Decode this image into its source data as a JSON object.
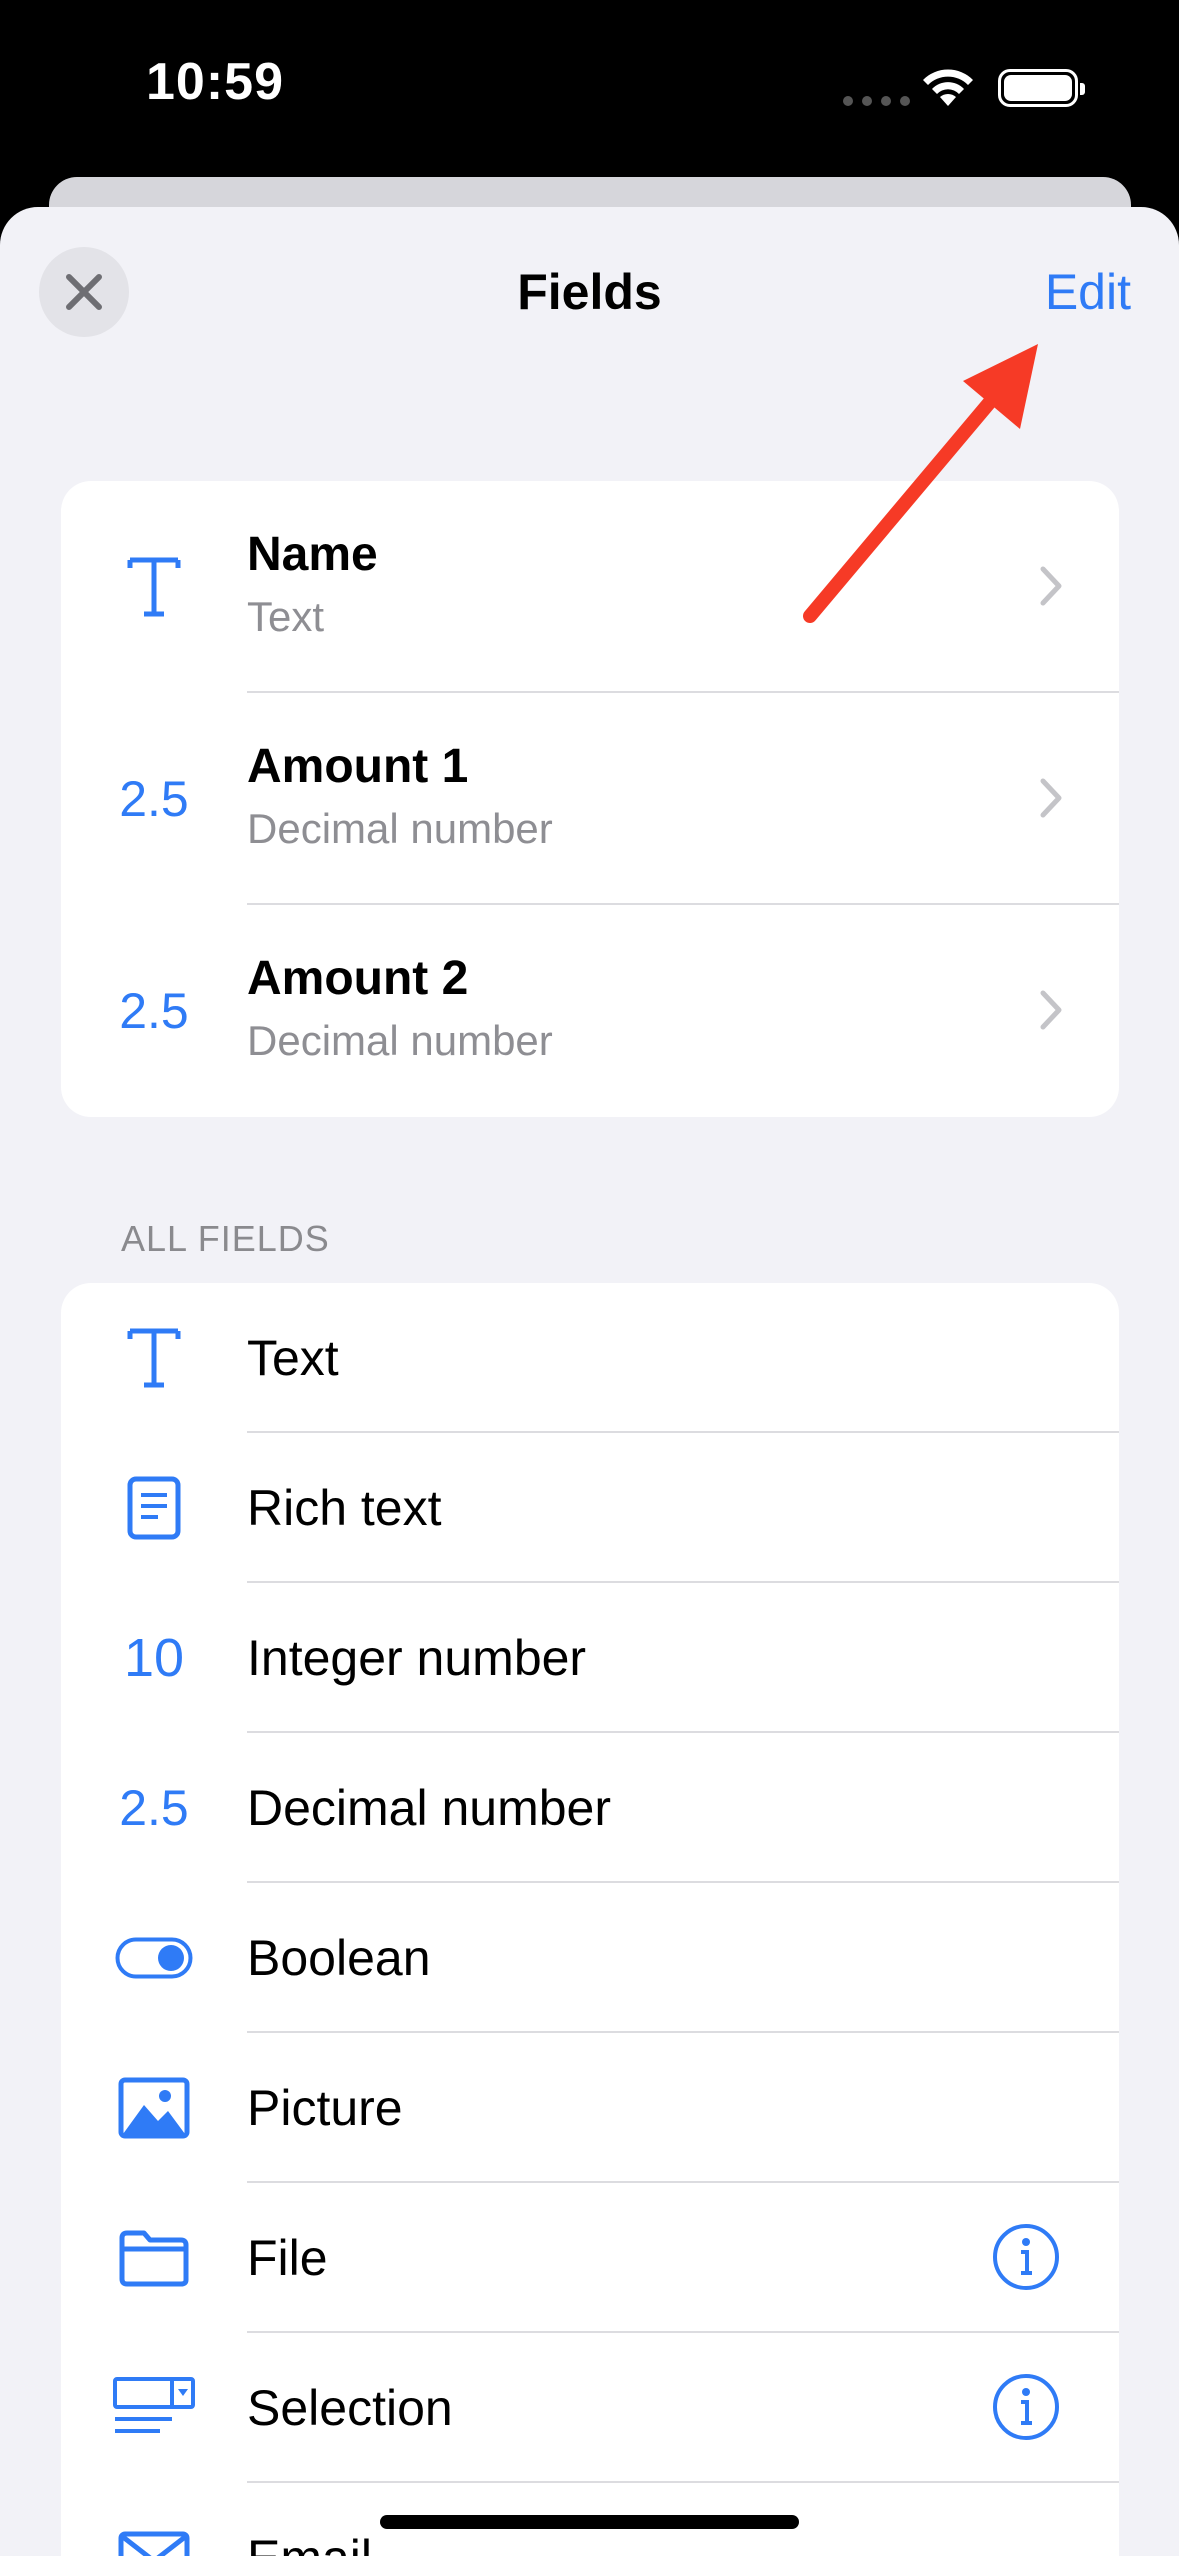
{
  "status_bar": {
    "time": "10:59"
  },
  "header": {
    "title": "Fields",
    "edit_label": "Edit"
  },
  "current_fields": [
    {
      "name": "Name",
      "type": "Text",
      "icon": "text-icon"
    },
    {
      "name": "Amount 1",
      "type": "Decimal number",
      "icon": "decimal-icon",
      "glyph": "2.5"
    },
    {
      "name": "Amount 2",
      "type": "Decimal number",
      "icon": "decimal-icon",
      "glyph": "2.5"
    }
  ],
  "all_fields_section": {
    "header": "ALL FIELDS",
    "items": [
      {
        "label": "Text",
        "icon": "text-icon"
      },
      {
        "label": "Rich text",
        "icon": "document-icon"
      },
      {
        "label": "Integer number",
        "icon": "integer-icon",
        "glyph": "10"
      },
      {
        "label": "Decimal number",
        "icon": "decimal-icon",
        "glyph": "2.5"
      },
      {
        "label": "Boolean",
        "icon": "toggle-icon"
      },
      {
        "label": "Picture",
        "icon": "picture-icon"
      },
      {
        "label": "File",
        "icon": "folder-icon",
        "has_info": true
      },
      {
        "label": "Selection",
        "icon": "selection-icon",
        "has_info": true
      },
      {
        "label": "Email",
        "icon": "envelope-icon"
      }
    ]
  },
  "colors": {
    "accent": "#2f7bf6",
    "annotation_arrow": "#f63a26",
    "background": "#f2f2f7"
  }
}
